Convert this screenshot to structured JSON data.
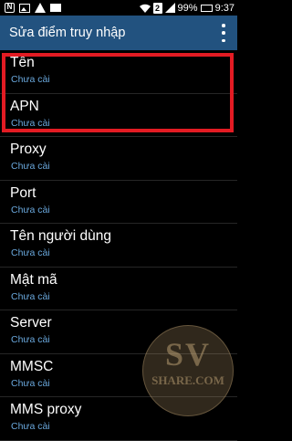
{
  "status_bar": {
    "icons_left": [
      "notification-n-icon",
      "image-icon",
      "warning-icon",
      "mail-icon"
    ],
    "icons_right": [
      "wifi-icon",
      "sim-2-icon",
      "signal-icon",
      "battery-icon"
    ],
    "sim_label": "2",
    "battery": "99%",
    "time": "9:37"
  },
  "action_bar": {
    "title": "Sửa điểm truy nhập",
    "background": "#22527f"
  },
  "settings": [
    {
      "label": "Tên",
      "value": "Chưa cài"
    },
    {
      "label": "APN",
      "value": "Chưa cài"
    },
    {
      "label": "Proxy",
      "value": "Chưa cài"
    },
    {
      "label": "Port",
      "value": "Chưa cài"
    },
    {
      "label": "Tên người dùng",
      "value": "Chưa cài"
    },
    {
      "label": "Mật mã",
      "value": "Chưa cài"
    },
    {
      "label": "Server",
      "value": "Chưa cài"
    },
    {
      "label": "MMSC",
      "value": "Chưa cài"
    },
    {
      "label": "MMS proxy",
      "value": "Chưa cài"
    }
  ],
  "watermark": {
    "line1": "SV",
    "line2": "SHARE.COM"
  },
  "colors": {
    "accent_text": "#6aa8dd",
    "highlight_border": "#e31b23"
  }
}
